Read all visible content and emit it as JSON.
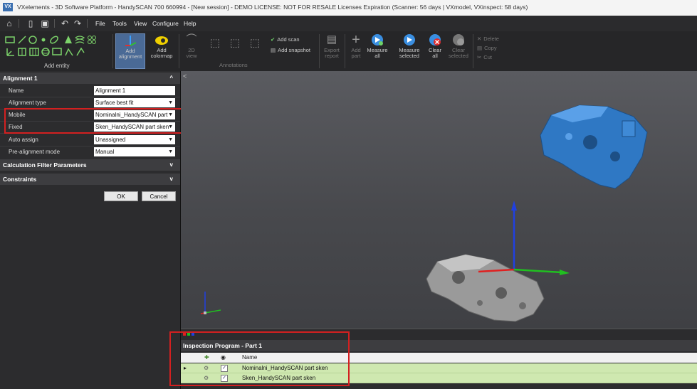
{
  "window": {
    "logo": "VX",
    "title": "VXelements - 3D Software Platform - HandySCAN 700 660994 - [New session] - DEMO LICENSE: NOT FOR RESALE Licenses Expiration (Scanner: 56 days | VXmodel, VXinspect: 58 days)"
  },
  "menubar": {
    "items": [
      "File",
      "Tools",
      "View",
      "Configure",
      "Help"
    ]
  },
  "ribbon": {
    "add_entity": "Add entity",
    "add_alignment": "Add\nalignment",
    "add_colormap": "Add\ncolormap",
    "view_2d": "2D\nview",
    "annotations": "Annotations",
    "add_scan": "Add scan",
    "add_snapshot": "Add snapshot",
    "export_report": "Export\nreport",
    "add_part": "Add\npart",
    "measure_all": "Measure\nall",
    "measure_selected": "Measure\nselected",
    "clear_all": "Clear\nall",
    "clear_selected": "Clear\nselected",
    "delete": "Delete",
    "copy": "Copy",
    "cut": "Cut"
  },
  "panel": {
    "header": "Alignment 1",
    "collapse_icon": "^",
    "props": [
      {
        "label": "Name",
        "value": "Alignment 1",
        "dropdown": false
      },
      {
        "label": "Alignment type",
        "value": "Surface best fit",
        "dropdown": true
      },
      {
        "label": "Mobile",
        "value": "Nominalni_HandySCAN part",
        "dropdown": true
      },
      {
        "label": "Fixed",
        "value": "Sken_HandySCAN part sken",
        "dropdown": true
      },
      {
        "label": "Auto assign",
        "value": "Unassigned",
        "dropdown": true
      },
      {
        "label": "Pre-alignment mode",
        "value": "Manual",
        "dropdown": true
      }
    ],
    "calc_filter": "Calculation Filter Parameters",
    "constraints": "Constraints",
    "expand_icon": "v",
    "ok": "OK",
    "cancel": "Cancel"
  },
  "viewport": {
    "collapse_arrow": "<"
  },
  "inspection": {
    "title": "Inspection Program - Part 1",
    "column_name": "Name",
    "rows": [
      {
        "name": "Nominalni_HandySCAN part sken",
        "checked": true,
        "expanded_marker": "▸"
      },
      {
        "name": "Sken_HandySCAN part sken",
        "checked": true,
        "expanded_marker": ""
      }
    ],
    "check_mark": "✓"
  },
  "colors": {
    "accent": "#4a6a96",
    "highlight_box": "#d32020",
    "row_green": "#cfe8b0",
    "part_blue": "#2f78c4",
    "part_gray": "#9a9a9a",
    "axis_x": "#e02020",
    "axis_y": "#20c020",
    "axis_z": "#2040e0"
  }
}
